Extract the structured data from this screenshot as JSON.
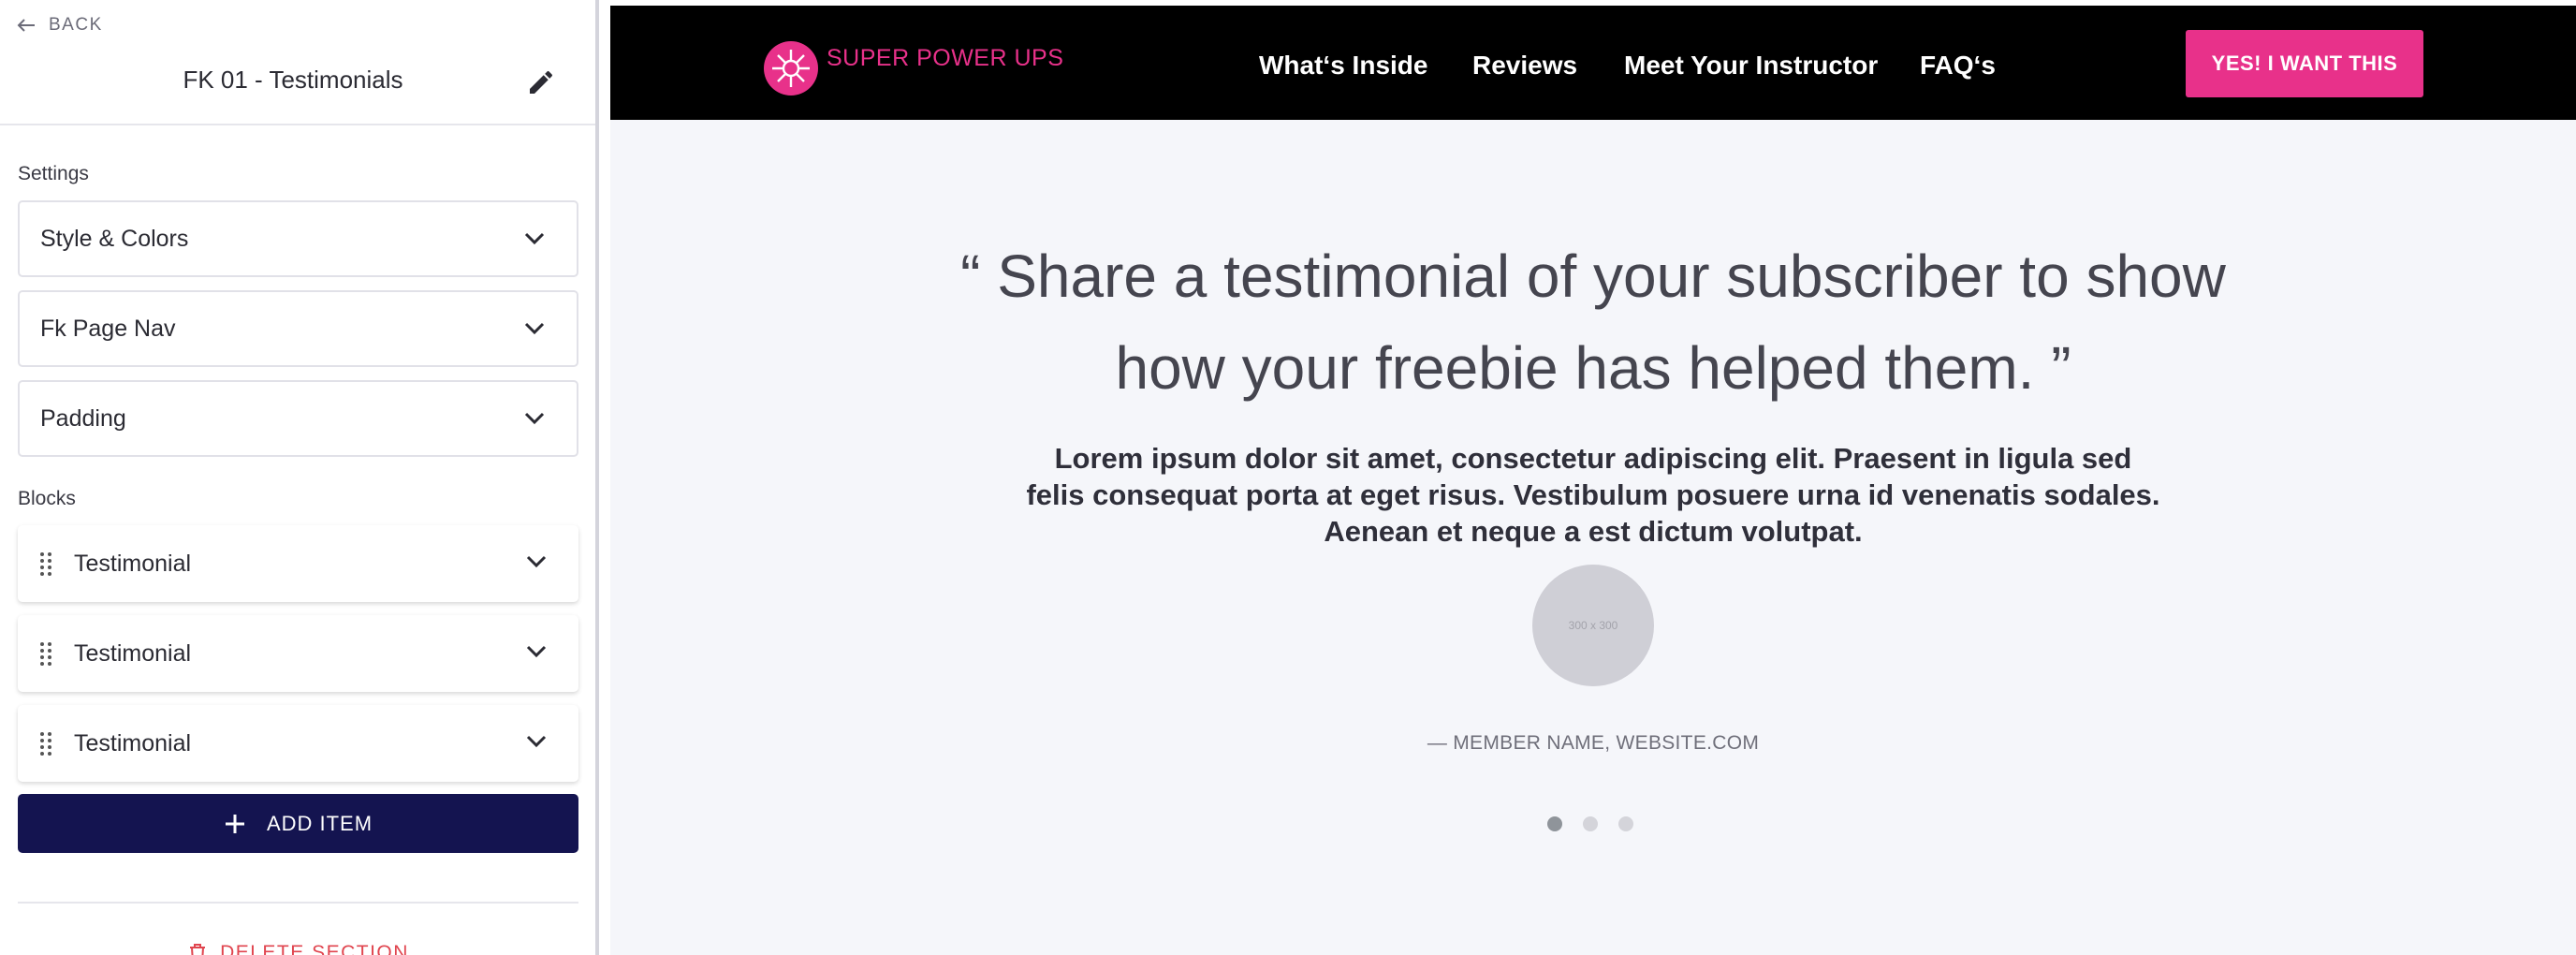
{
  "editor": {
    "back_label": "BACK",
    "section_title": "FK 01 - Testimonials",
    "settings_label": "Settings",
    "settings": [
      {
        "label": "Style & Colors"
      },
      {
        "label": "Fk Page Nav"
      },
      {
        "label": "Padding"
      }
    ],
    "blocks_label": "Blocks",
    "blocks": [
      {
        "label": "Testimonial"
      },
      {
        "label": "Testimonial"
      },
      {
        "label": "Testimonial"
      }
    ],
    "add_item_label": "ADD ITEM",
    "delete_label": "DELETE SECTION",
    "accent_color": "#141450",
    "danger_color": "#e0454f"
  },
  "preview": {
    "brand": "SUPER POWER UPS",
    "nav_links": [
      "What‘s Inside",
      "Reviews",
      "Meet Your Instructor",
      "FAQ‘s"
    ],
    "cta_label": "YES! I WANT THIS",
    "brand_color": "#e8318a",
    "testimonial": {
      "quote": "“ Share a testimonial of your subscriber to show how your freebie has helped them. ”",
      "body": "Lorem ipsum dolor sit amet, consectetur adipiscing elit. Praesent in ligula sed felis consequat porta at eget risus. Vestibulum posuere urna id venenatis sodales. Aenean et neque a est dictum volutpat.",
      "avatar_placeholder": "300 x 300",
      "member": "— MEMBER NAME, WEBSITE.COM"
    },
    "slider": {
      "count": 3,
      "active": 1
    }
  }
}
